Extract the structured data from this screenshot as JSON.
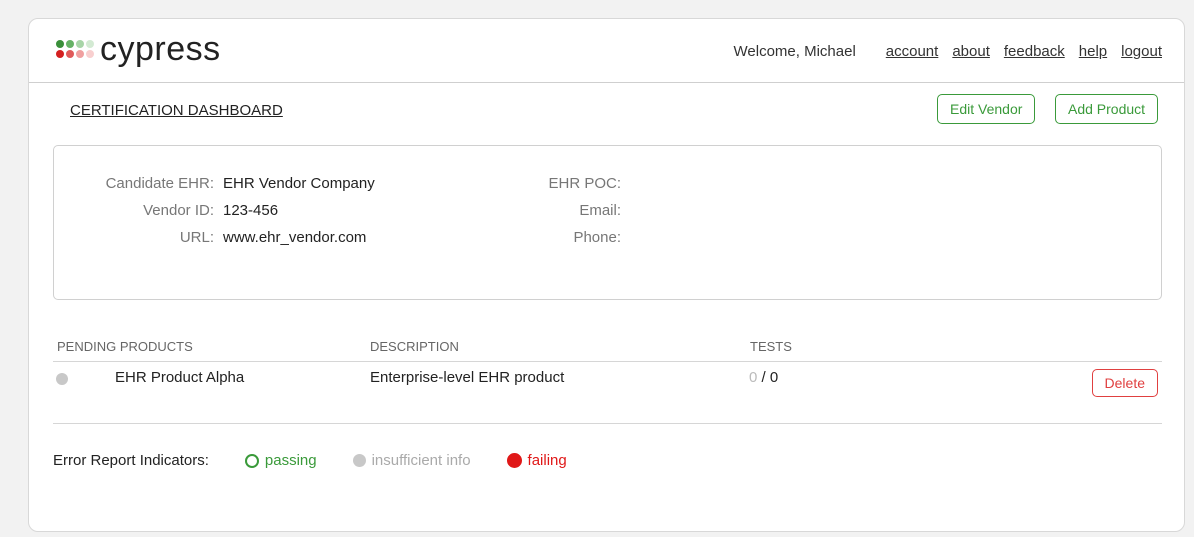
{
  "brand": {
    "name": "cypress",
    "dot_colors": [
      "#3a8f3a",
      "#66b266",
      "#a8d5a8",
      "#d3ead3",
      "#d42020",
      "#e05a5a",
      "#f0a0a0",
      "#f8cfcf"
    ]
  },
  "nav": {
    "welcome": "Welcome, Michael",
    "links": [
      "account",
      "about",
      "feedback",
      "help",
      "logout"
    ]
  },
  "page": {
    "title": "CERTIFICATION DASHBOARD",
    "edit_vendor": "Edit Vendor",
    "add_product": "Add Product"
  },
  "vendor": {
    "candidate_label": "Candidate EHR:",
    "candidate_value": "EHR Vendor Company",
    "vendor_id_label": "Vendor ID:",
    "vendor_id_value": "123-456",
    "url_label": "URL:",
    "url_value": "www.ehr_vendor.com",
    "poc_label": "EHR POC:",
    "email_label": "Email:",
    "phone_label": "Phone:"
  },
  "products": {
    "headers": [
      "PENDING PRODUCTS",
      "DESCRIPTION",
      "TESTS"
    ],
    "rows": [
      {
        "name": "EHR Product Alpha",
        "description": "Enterprise-level EHR product",
        "tests_passed": "0",
        "tests_sep": " / ",
        "tests_total": "0",
        "delete": "Delete"
      }
    ]
  },
  "legend": {
    "label": "Error Report Indicators:",
    "passing": "passing",
    "insufficient": "insufficient info",
    "failing": "failing",
    "colors": {
      "passing": "#3a9a3a",
      "insufficient": "#c8c8c8",
      "failing": "#e01818"
    }
  }
}
